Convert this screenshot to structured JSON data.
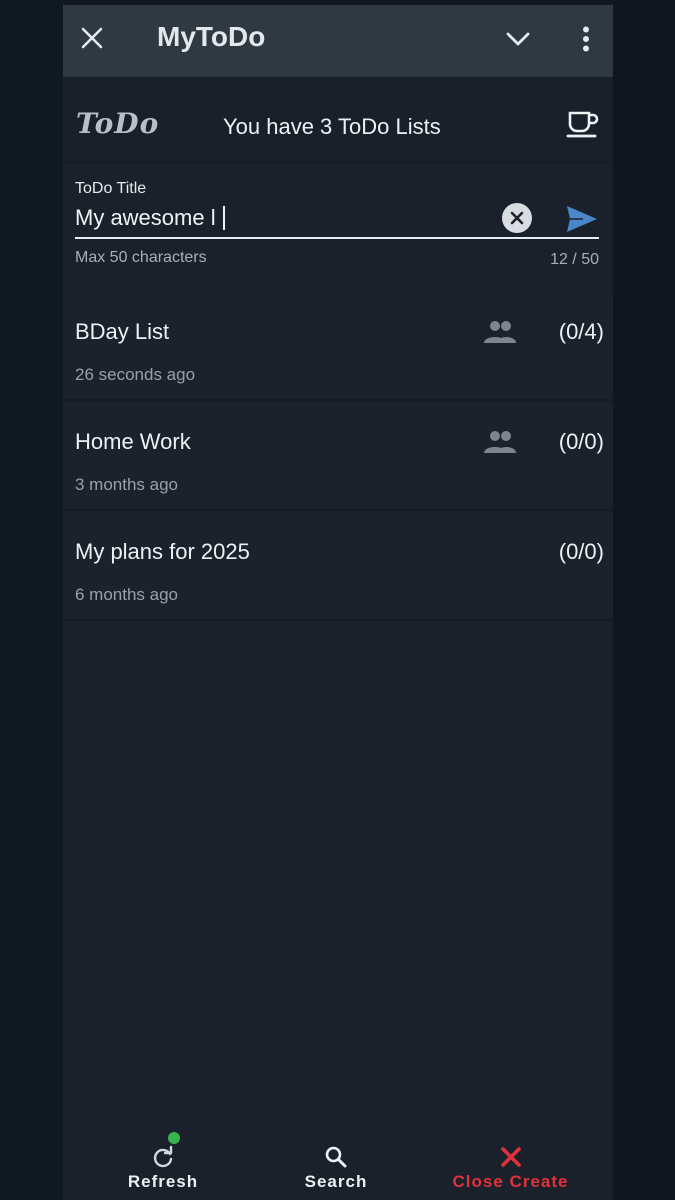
{
  "app": {
    "title": "MyToDo",
    "logo_text": "ToDo"
  },
  "header": {
    "count_text": "You have 3 ToDo Lists"
  },
  "form": {
    "label": "ToDo Title",
    "value": "My awesome l",
    "helper": "Max 50 characters",
    "counter": "12 / 50"
  },
  "lists": [
    {
      "title": "BDay List",
      "time": "26 seconds ago",
      "count": "(0/4)",
      "shared": true
    },
    {
      "title": "Home Work",
      "time": "3 months ago",
      "count": "(0/0)",
      "shared": true
    },
    {
      "title": "My plans for 2025",
      "time": "6 months ago",
      "count": "(0/0)",
      "shared": false
    }
  ],
  "bottom_nav": {
    "refresh_label": "Refresh",
    "search_label": "Search",
    "close_label": "Close Create"
  },
  "colors": {
    "accent_send": "#4a86c8",
    "close_red": "#e0323c",
    "badge_green": "#37b44e"
  },
  "icons": {
    "close": "close-icon",
    "chevron": "chevron-down-icon",
    "more": "more-vert-icon",
    "cup": "coffee-cup-icon",
    "clear": "clear-circle-icon",
    "send": "send-icon",
    "shared": "group-icon",
    "refresh": "refresh-icon",
    "search": "search-icon",
    "close_create": "close-x-icon"
  }
}
